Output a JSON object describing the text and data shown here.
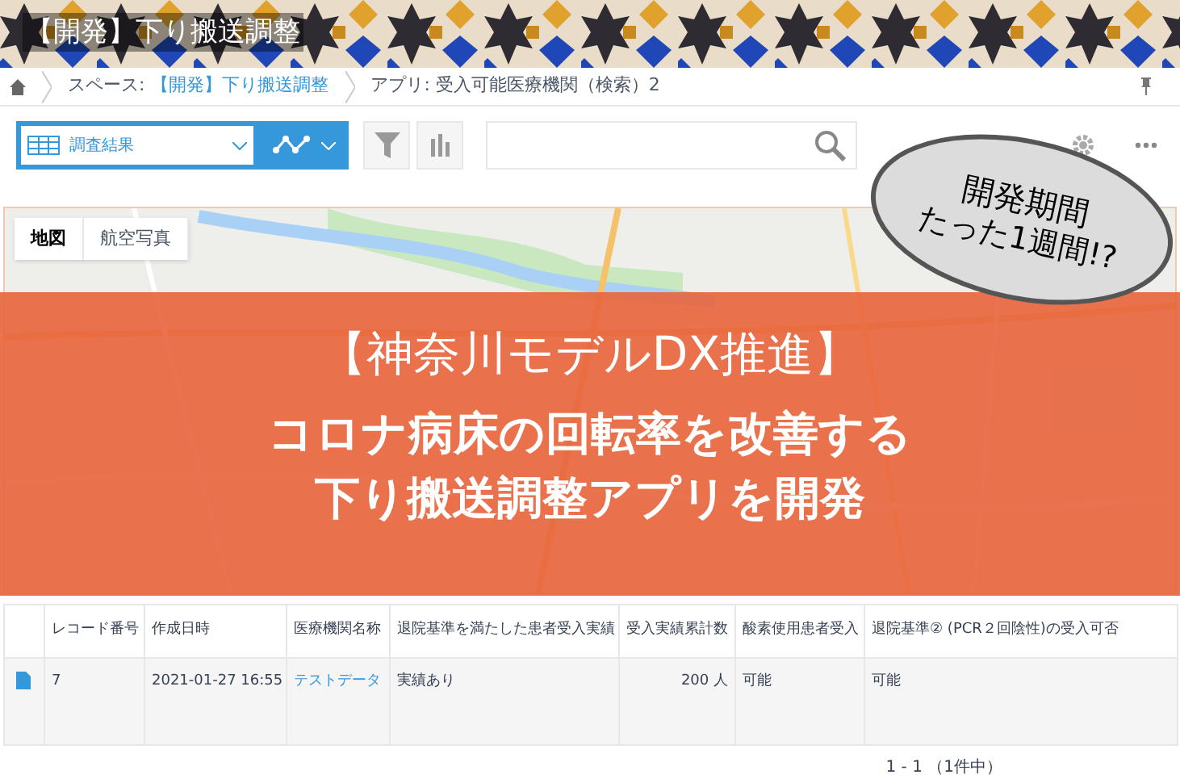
{
  "header": {
    "title": "【開発】下り搬送調整"
  },
  "breadcrumb": {
    "space_label": "スペース:",
    "space_link": "【開発】下り搬送調整",
    "app": "アプリ: 受入可能医療機関（検索）2"
  },
  "toolbar": {
    "view": "調査結果"
  },
  "map": {
    "tabs": [
      {
        "label": "地図",
        "selected": true
      },
      {
        "label": "航空写真",
        "selected": false
      }
    ]
  },
  "banner": {
    "lines": [
      "【神奈川モデルDX推進】",
      "コロナ病床の回転率を改善する",
      "下り搬送調整アプリを開発"
    ]
  },
  "bubble": {
    "lines": [
      "開発期間",
      "たった1週間!?"
    ]
  },
  "table": {
    "columns": [
      "レコード番号",
      "作成日時",
      "医療機関名称",
      "退院基準を満たした患者受入実績",
      "受入実績累計数",
      "酸素使用患者受入",
      "退院基準② (PCR２回陰性)の受入可否"
    ],
    "rows": [
      {
        "cells": [
          {
            "kind": "text",
            "text": "7"
          },
          {
            "kind": "text",
            "text": "2021-01-27 16:55"
          },
          {
            "kind": "link",
            "text": "テストデータ"
          },
          {
            "kind": "text",
            "text": "実績あり"
          },
          {
            "kind": "number",
            "text": "200 人"
          },
          {
            "kind": "text",
            "text": "可能"
          },
          {
            "kind": "text",
            "text": "可能"
          }
        ]
      }
    ]
  },
  "pagination": "1 - 1 （1件中）"
}
